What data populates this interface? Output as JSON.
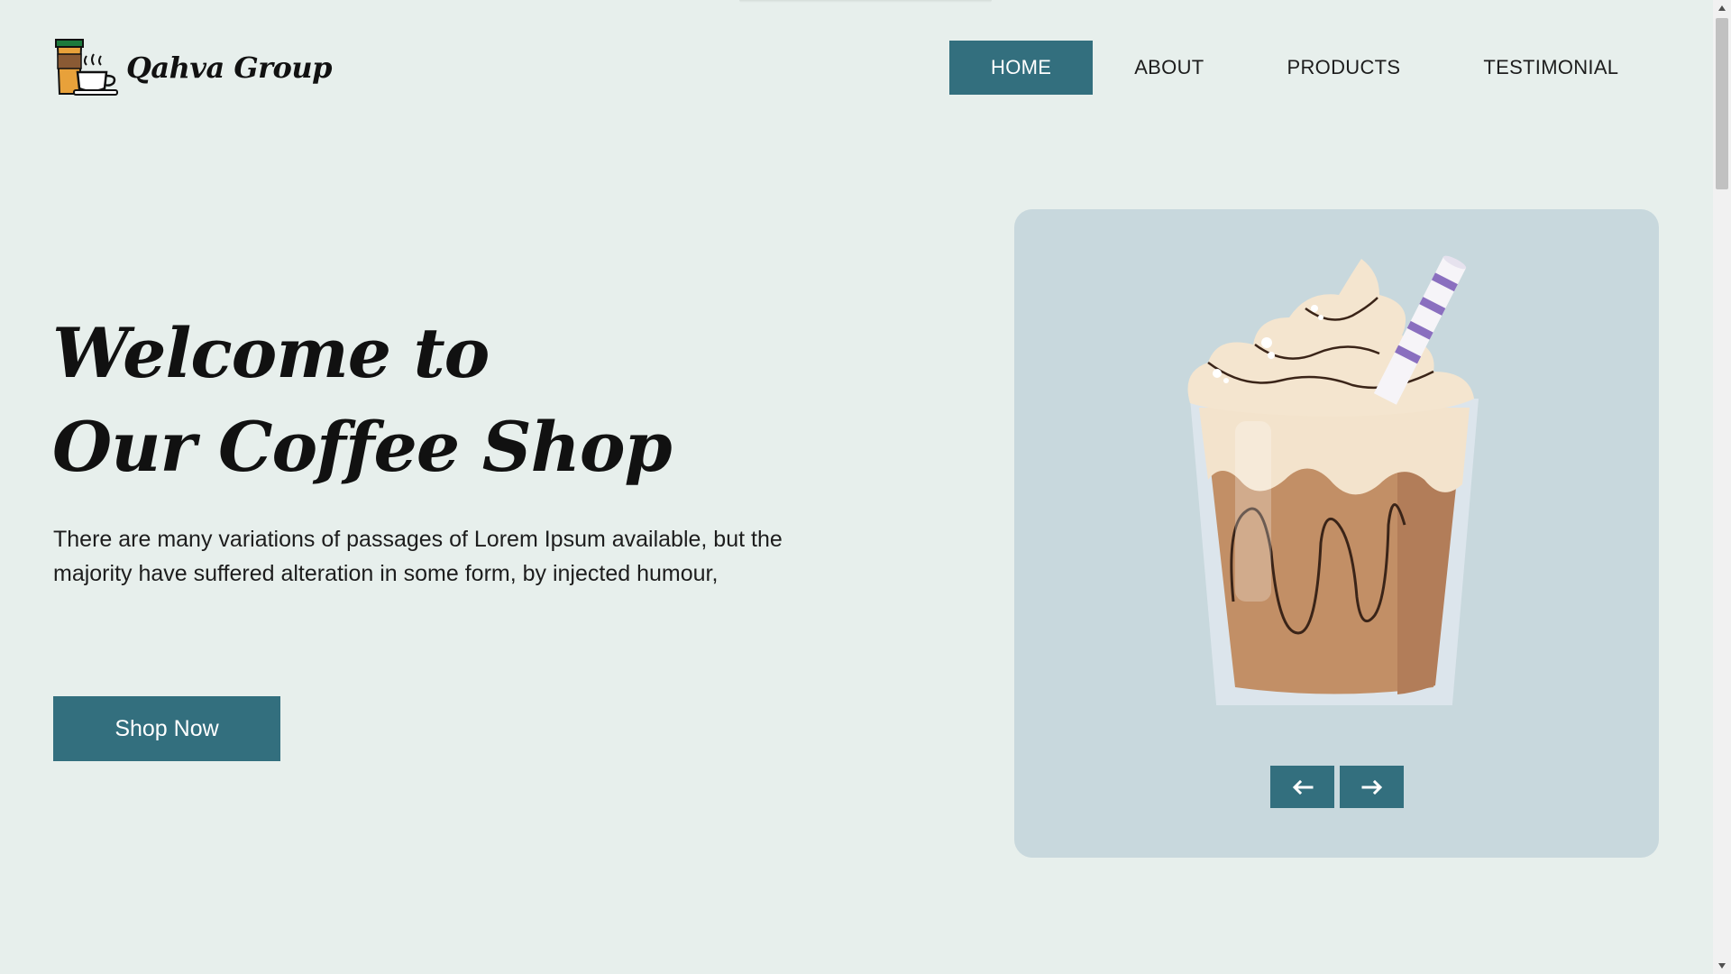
{
  "brand": {
    "name": "Qahva Group"
  },
  "nav": {
    "items": [
      {
        "label": "HOME",
        "active": true
      },
      {
        "label": "ABOUT",
        "active": false
      },
      {
        "label": "PRODUCTS",
        "active": false
      },
      {
        "label": "TESTIMONIAL",
        "active": false
      }
    ]
  },
  "hero": {
    "title_line1": "Welcome to",
    "title_line2": "Our Coffee Shop",
    "description": "There are many variations of passages of Lorem Ipsum available, but the majority have suffered alteration in some form, by injected humour,",
    "cta_label": "Shop Now"
  },
  "slider": {
    "prev_icon": "arrow-left-icon",
    "next_icon": "arrow-right-icon",
    "image_subject": "iced-mocha-drink-illustration"
  },
  "colors": {
    "background": "#e7efec",
    "accent": "#336f7e",
    "card": "#c8d8dd"
  }
}
